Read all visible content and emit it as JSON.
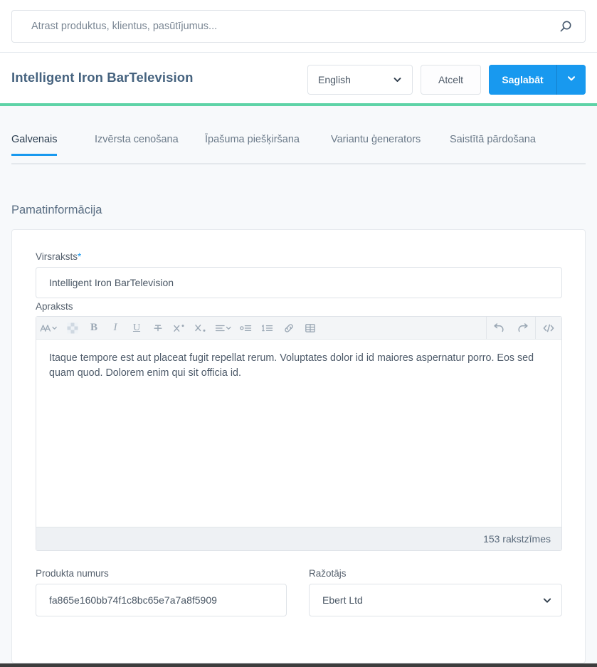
{
  "search": {
    "placeholder": "Atrast produktus, klientus, pasūtījumus...",
    "value": "",
    "icon": "search-icon"
  },
  "header": {
    "title": "Intelligent Iron BarTelevision",
    "language_select": {
      "value": "English",
      "icon": "chevron-down-icon"
    },
    "cancel_label": "Atcelt",
    "save_label": "Saglabāt",
    "save_caret_icon": "chevron-down-icon"
  },
  "accent": {
    "primary": "#1899ef",
    "rule_green": "#5ed3a7",
    "page_bg": "#f7f9fb",
    "card_bg": "#ffffff",
    "border": "#dfe3e8"
  },
  "tabs": [
    {
      "label": "Galvenais",
      "active": true
    },
    {
      "label": "Izvērsta cenošana",
      "active": false
    },
    {
      "label": "Īpašuma piešķiršana",
      "active": false
    },
    {
      "label": "Variantu ģenerators",
      "active": false
    },
    {
      "label": "Saistītā pārdošana",
      "active": false
    }
  ],
  "main": {
    "section_title": "Pamatinformācija",
    "fields": {
      "title": {
        "label": "Virsraksts",
        "required_marker": "*",
        "value": "Intelligent Iron BarTelevision"
      },
      "description": {
        "label": "Apraksts",
        "value": "Itaque tempore est aut placeat fugit repellat rerum. Voluptates dolor id id maiores aspernatur porro. Eos sed quam quod. Dolorem enim qui sit officia id.",
        "char_count": "153 rakstzīmes"
      },
      "product_number": {
        "label": "Produkta numurs",
        "value": "fa865e160bb74f1c8bc65e7a7a8f5909"
      },
      "manufacturer": {
        "label": "Ražotājs",
        "value": "Ebert Ltd",
        "icon": "chevron-down-icon"
      }
    },
    "editor_toolbar": [
      {
        "name": "font-family-icon",
        "glyph": "A"
      },
      {
        "name": "background-color-icon",
        "glyph": ""
      },
      {
        "name": "bold-icon",
        "glyph": "B"
      },
      {
        "name": "italic-icon",
        "glyph": "I"
      },
      {
        "name": "underline-icon",
        "glyph": "U"
      },
      {
        "name": "strikethrough-icon",
        "glyph": "S"
      },
      {
        "name": "superscript-icon",
        "glyph": "X"
      },
      {
        "name": "subscript-icon",
        "glyph": "X"
      },
      {
        "name": "align-icon",
        "glyph": ""
      },
      {
        "name": "bullet-list-icon",
        "glyph": ""
      },
      {
        "name": "numbered-list-icon",
        "glyph": ""
      },
      {
        "name": "link-icon",
        "glyph": ""
      },
      {
        "name": "table-icon",
        "glyph": ""
      },
      {
        "name": "undo-icon",
        "glyph": ""
      },
      {
        "name": "redo-icon",
        "glyph": ""
      },
      {
        "name": "code-view-icon",
        "glyph": ""
      }
    ]
  }
}
